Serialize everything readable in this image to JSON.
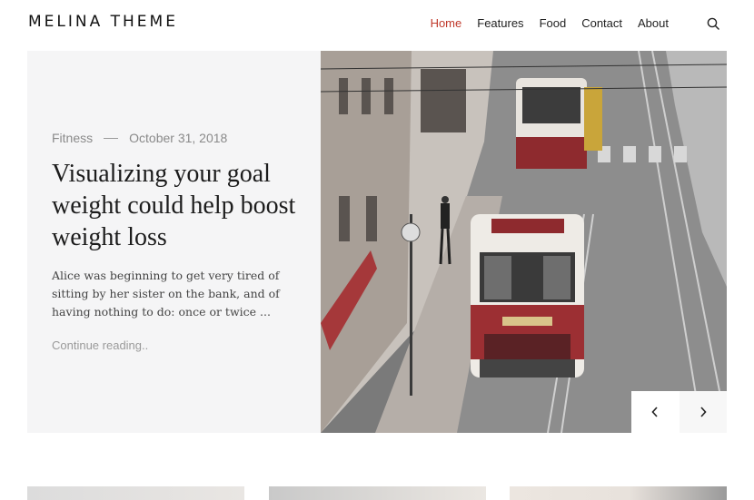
{
  "site": {
    "title": "MELINA THEME"
  },
  "nav": {
    "items": [
      {
        "label": "Home",
        "active": true
      },
      {
        "label": "Features",
        "active": false
      },
      {
        "label": "Food",
        "active": false
      },
      {
        "label": "Contact",
        "active": false
      },
      {
        "label": "About",
        "active": false
      }
    ],
    "search_icon": "search-icon"
  },
  "hero": {
    "category": "Fitness",
    "date": "October 31, 2018",
    "title": "Visualizing your goal weight could help boost weight loss",
    "excerpt": "Alice was beginning to get very tired of sitting by her sister on the bank, and of having nothing to do: once or twice ...",
    "continue_label": "Continue reading..",
    "image_icon": "tram-street-photo",
    "prev_icon": "chevron-left-icon",
    "next_icon": "chevron-right-icon"
  },
  "colors": {
    "accent": "#c0392b",
    "panel": "#f5f5f6",
    "muted": "#8a8a8a"
  }
}
